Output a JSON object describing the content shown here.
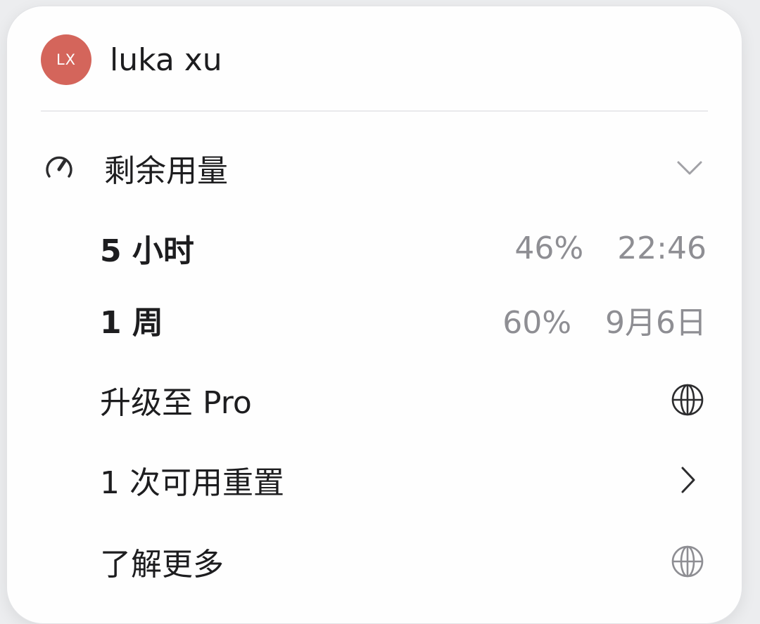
{
  "user": {
    "initials": "LX",
    "name": "luka xu",
    "avatar_color": "#d4655b"
  },
  "usage_section": {
    "title": "剩余用量",
    "icon": "gauge-icon",
    "toggle_icon": "chevron-down-icon",
    "items": [
      {
        "label": "5 小时",
        "percent": "46%",
        "reset_time": "22:46"
      },
      {
        "label": "1 周",
        "percent": "60%",
        "reset_time": "9月6日"
      }
    ]
  },
  "menu_items": [
    {
      "label": "升级至 Pro",
      "icon": "globe-icon"
    },
    {
      "label": "1 次可用重置",
      "icon": "chevron-right-icon"
    },
    {
      "label": "了解更多",
      "icon": "globe-icon"
    }
  ]
}
